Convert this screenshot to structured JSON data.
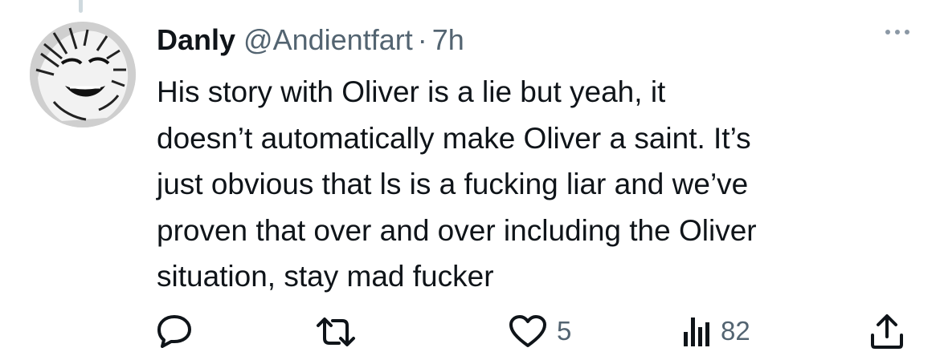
{
  "tweet": {
    "display_name": "Danly",
    "handle": "@Andientfart",
    "separator": "·",
    "time": "7h",
    "text": "His story with Oliver is a lie but yeah, it\ndoesn’t automatically make Oliver a saint. It’s\njust obvious that ls is a fucking liar and we’ve\nproven that over and over including the Oliver\nsituation, stay mad fucker"
  },
  "actions": {
    "reply_icon": "reply-icon",
    "retweet_icon": "retweet-icon",
    "like_icon": "heart-icon",
    "like_count": "5",
    "views_icon": "views-icon",
    "views_count": "82",
    "share_icon": "share-icon"
  },
  "colors": {
    "text": "#0f1419",
    "secondary": "#536471",
    "background": "#ffffff"
  }
}
